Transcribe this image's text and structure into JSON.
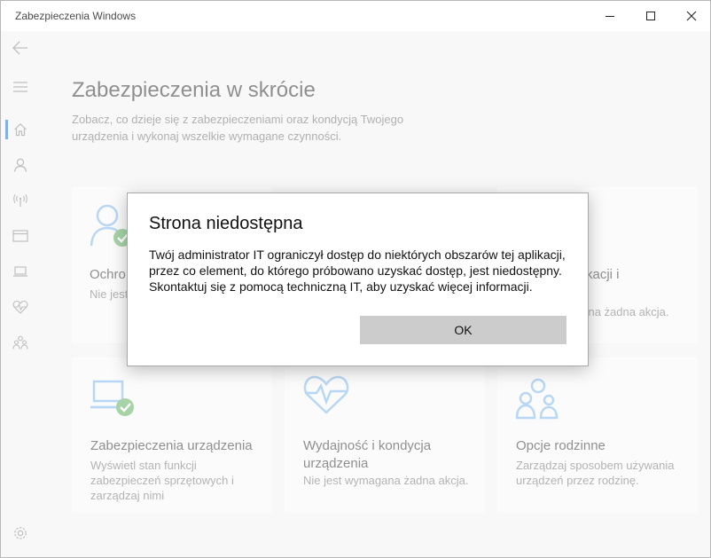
{
  "window": {
    "title": "Zabezpieczenia Windows"
  },
  "nav": {
    "items": [
      {
        "icon": "back-arrow-icon"
      },
      {
        "icon": "hamburger-menu-icon"
      },
      {
        "icon": "home-icon",
        "active": true
      },
      {
        "icon": "person-icon"
      },
      {
        "icon": "wireless-antenna-icon"
      },
      {
        "icon": "app-browser-icon"
      },
      {
        "icon": "laptop-icon"
      },
      {
        "icon": "heart-pulse-icon"
      },
      {
        "icon": "family-icon"
      },
      {
        "icon": "settings-gear-icon"
      }
    ],
    "accent": "#1f6fd1"
  },
  "main": {
    "title": "Zabezpieczenia w skrócie",
    "subtitle": "Zobacz, co dzieje się z zabezpieczeniami oraz kondycją Twojego urządzenia i wykonaj wszelkie wymagane czynności."
  },
  "tiles": [
    {
      "icon": "person-shield-icon",
      "title": "Ochro",
      "desc": "Nie jest"
    },
    {
      "icon": "app-browser-icon",
      "title": "kacji i",
      "desc": "gana żadna akcja."
    },
    {
      "icon": "laptop-check-icon",
      "title": "Zabezpieczenia urządzenia",
      "desc": "Wyświetl stan funkcji zabezpieczeń sprzętowych i zarządzaj nimi"
    },
    {
      "icon": "heart-pulse-icon",
      "title": "Wydajność i kondycja urządzenia",
      "desc": "Nie jest wymagana żadna akcja."
    },
    {
      "icon": "family-icon",
      "title": "Opcje rodzinne",
      "desc": "Zarządzaj sposobem używania urządzeń przez rodzinę."
    }
  ],
  "dialog": {
    "title": "Strona niedostępna",
    "body": "Twój administrator IT ograniczył dostęp do niektórych obszarów tej aplikacji, przez co element, do którego próbowano uzyskać dostęp, jest niedostępny. Skontaktuj się z pomocą techniczną IT, aby uzyskać więcej informacji.",
    "ok_label": "OK"
  },
  "colors": {
    "tile_icon_blue": "#5aa0e6",
    "check_green": "#5fb05f"
  }
}
